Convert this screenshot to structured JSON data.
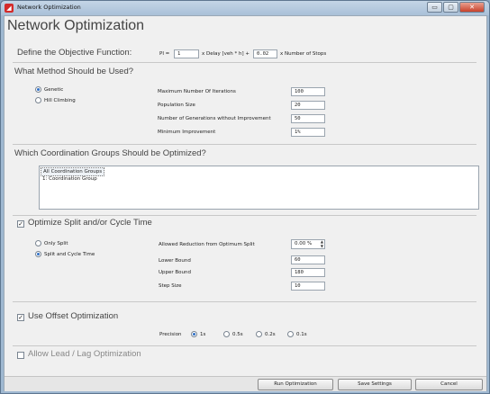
{
  "window": {
    "title": "Network Optimization",
    "icon": "app-logo-icon",
    "min_glyph": "▭",
    "max_glyph": "▢",
    "close_glyph": "✕"
  },
  "heading": "Network Optimization",
  "objective": {
    "label": "Define the Objective Function:",
    "pi_label": "PI =",
    "delay_weight": "1",
    "delay_text": "x Delay [veh * h] +",
    "stops_weight": "0.02",
    "stops_text": "x Number of Stops"
  },
  "method": {
    "label": "What Method Should be Used?",
    "options": [
      "Genetic",
      "Hill Climbing"
    ],
    "selected": "Genetic",
    "params": [
      {
        "label": "Maximum Number Of Iterations",
        "value": "100"
      },
      {
        "label": "Population Size",
        "value": "20"
      },
      {
        "label": "Number of Generations without Improvement",
        "value": "50"
      },
      {
        "label": "Minimum Improvement",
        "value": "1%"
      }
    ]
  },
  "coordination": {
    "label": "Which Coordination Groups Should be Optimized?",
    "items": [
      "All Coordination Groups",
      "1: Coordination Group"
    ],
    "selected": "All Coordination Groups"
  },
  "split": {
    "label": "Optimize Split and/or Cycle Time",
    "checked": true,
    "check_glyph": "✓",
    "options": [
      "Only Split",
      "Split and Cycle Time"
    ],
    "selected": "Split and Cycle Time",
    "reduction_label": "Allowed Reduction from Optimum Split",
    "reduction_value": "0.00 %",
    "spin_up": "▲",
    "spin_down": "▼",
    "params": [
      {
        "label": "Lower Bound",
        "value": "60"
      },
      {
        "label": "Upper Bound",
        "value": "180"
      },
      {
        "label": "Step Size",
        "value": "10"
      }
    ]
  },
  "offset": {
    "label": "Use Offset Optimization",
    "checked": true,
    "check_glyph": "✓",
    "precision_label": "Precision",
    "options": [
      "1s",
      "0.5s",
      "0.2s",
      "0.1s"
    ],
    "selected": "1s"
  },
  "leadlag": {
    "label": "Allow Lead / Lag Optimization",
    "checked": false
  },
  "buttons": {
    "run": "Run Optimization",
    "save": "Save Settings",
    "cancel": "Cancel"
  }
}
